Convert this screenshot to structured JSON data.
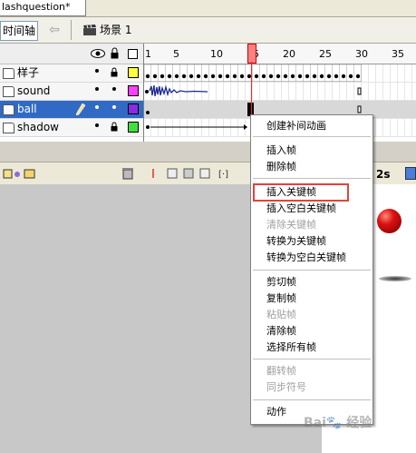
{
  "document": {
    "tab_title": "lashquestion*"
  },
  "toolbar": {
    "timeline_button": "时间轴",
    "back_glyph": "⇦",
    "scene_label": "场景 1"
  },
  "ruler": {
    "ticks": [
      "1",
      "5",
      "10",
      "15",
      "20",
      "25",
      "30",
      "35"
    ]
  },
  "layers": [
    {
      "name": "样子",
      "color": "#ffff40"
    },
    {
      "name": "sound",
      "color": "#ff40ff"
    },
    {
      "name": "ball",
      "color": "#8a2be2"
    },
    {
      "name": "shadow",
      "color": "#40e040"
    }
  ],
  "status": {
    "fps_suffix": "2s"
  },
  "context_menu": {
    "items": [
      {
        "label": "创建补间动画",
        "enabled": true
      },
      {
        "label": "插入帧",
        "enabled": true
      },
      {
        "label": "删除帧",
        "enabled": true
      },
      {
        "label": "插入关键帧",
        "enabled": true,
        "highlighted": true
      },
      {
        "label": "插入空白关键帧",
        "enabled": true
      },
      {
        "label": "清除关键帧",
        "enabled": false
      },
      {
        "label": "转换为关键帧",
        "enabled": true
      },
      {
        "label": "转换为空白关键帧",
        "enabled": true
      },
      {
        "label": "剪切帧",
        "enabled": true
      },
      {
        "label": "复制帧",
        "enabled": true
      },
      {
        "label": "粘贴帧",
        "enabled": false
      },
      {
        "label": "清除帧",
        "enabled": true
      },
      {
        "label": "选择所有帧",
        "enabled": true
      },
      {
        "label": "翻转帧",
        "enabled": false
      },
      {
        "label": "同步符号",
        "enabled": false
      },
      {
        "label": "动作",
        "enabled": true
      }
    ]
  },
  "watermark": "Bai&#xe5; 经验",
  "colors": {
    "highlight_border": "#e0453a",
    "selection": "#316ac5",
    "playhead": "#ff4040"
  }
}
